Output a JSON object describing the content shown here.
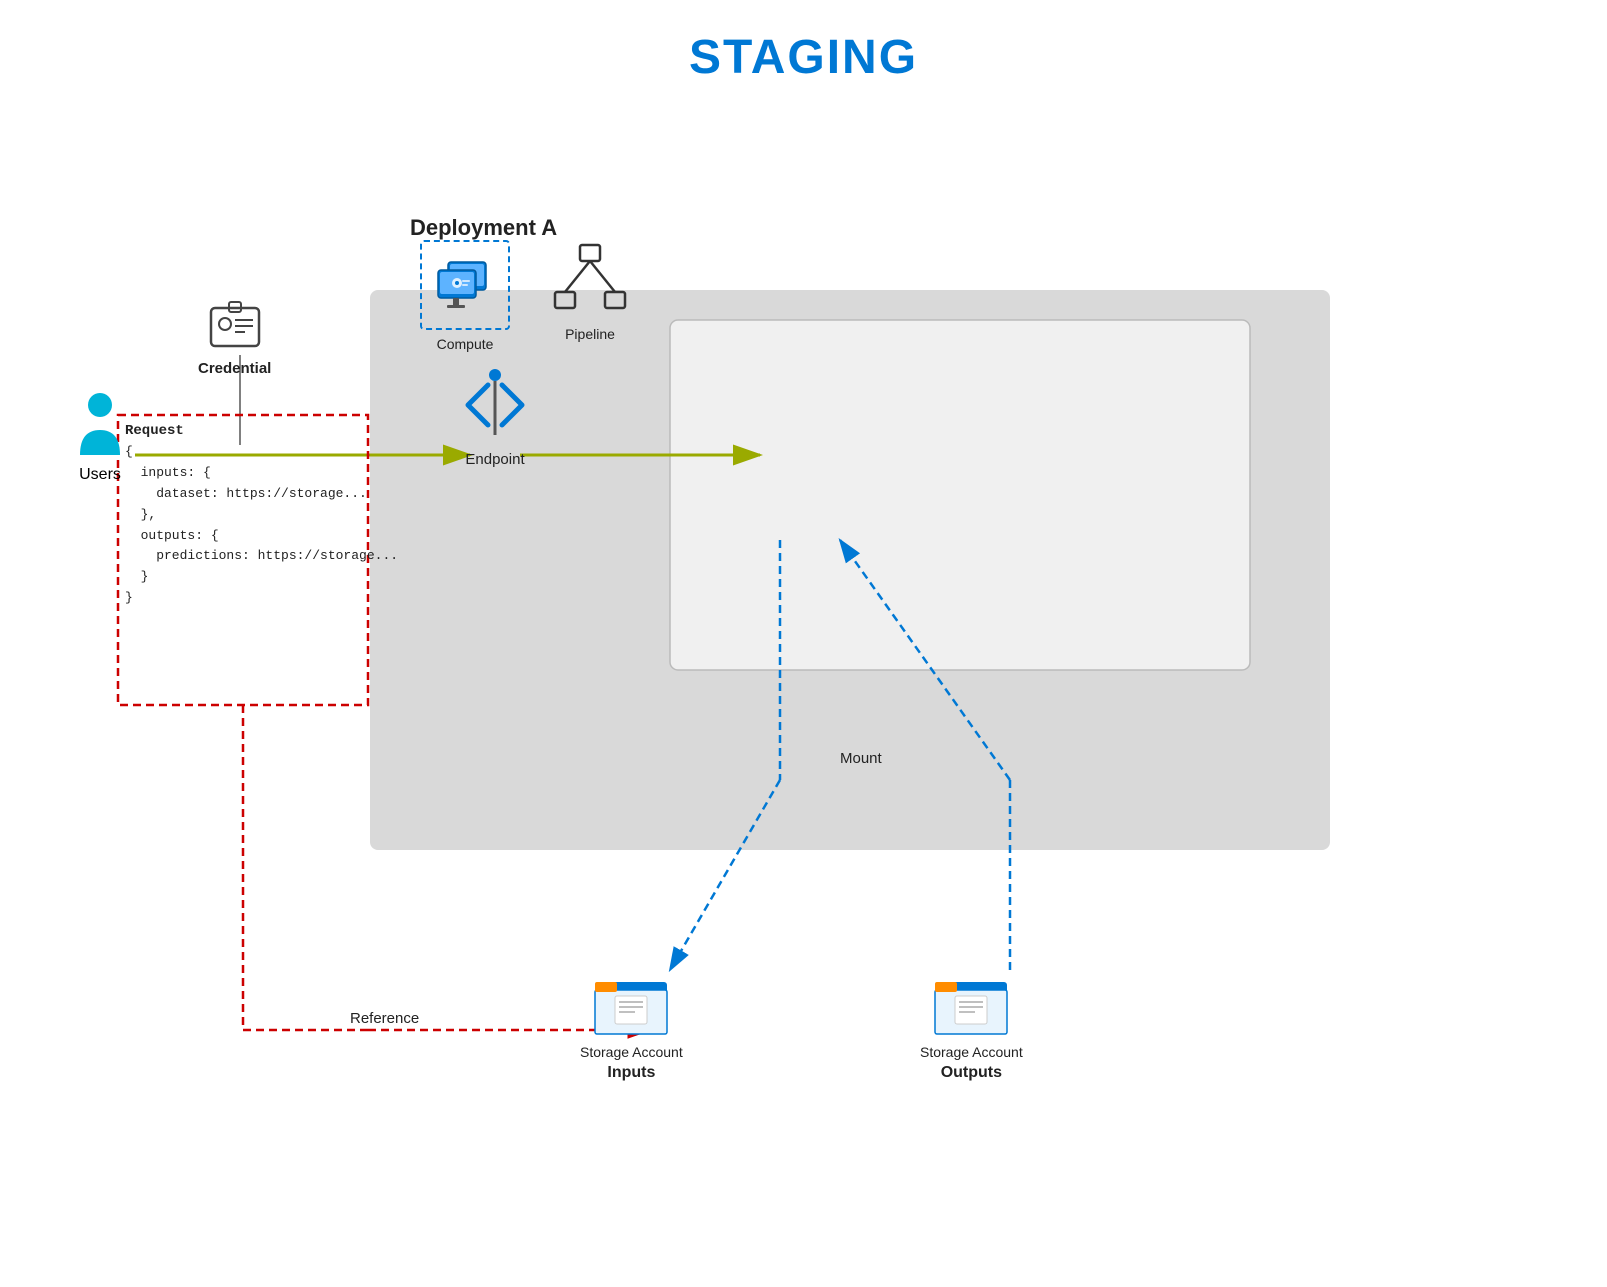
{
  "page": {
    "title": "STAGING",
    "title_color": "#0078d4"
  },
  "diagram": {
    "deployment_label": "Deployment A",
    "users_label": "Users",
    "credential_label": "Credential",
    "endpoint_label": "Endpoint",
    "compute_label": "Compute",
    "pipeline_label": "Pipeline",
    "mount_label": "Mount",
    "reference_label": "Reference",
    "storage_inputs_label": "Storage Account",
    "storage_inputs_sublabel": "Inputs",
    "storage_outputs_label": "Storage Account",
    "storage_outputs_sublabel": "Outputs",
    "request_title": "Request",
    "request_body": "{\n  inputs: {\n    dataset: https://storage...\n  },\n  outputs: {\n    predictions: https://storage...\n  }\n}"
  }
}
